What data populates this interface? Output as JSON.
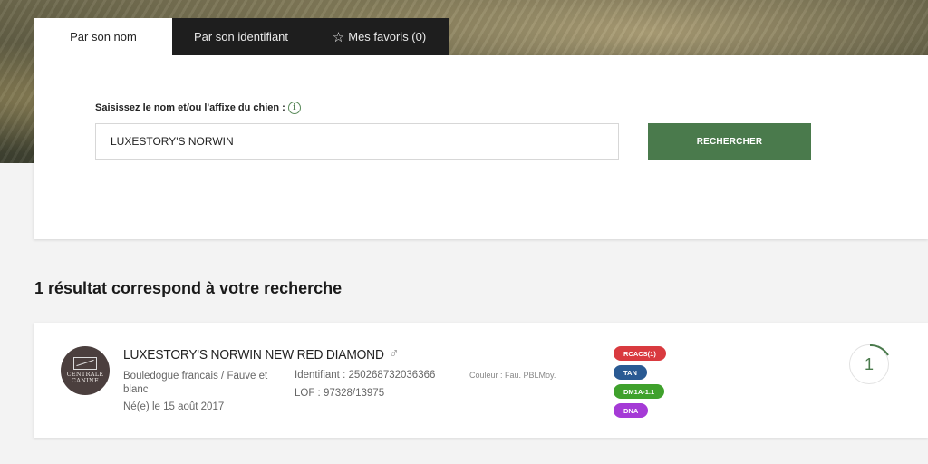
{
  "tabs": [
    {
      "label": "Par son nom",
      "active": true
    },
    {
      "label": "Par son identifiant",
      "active": false
    },
    {
      "label": "Mes favoris (0)",
      "active": false,
      "icon": "star-icon"
    }
  ],
  "search": {
    "label": "Saisissez le nom et/ou l'affixe du chien :",
    "info_icon": "i",
    "value": "LUXESTORY'S NORWIN",
    "button_label": "RECHERCHER"
  },
  "results": {
    "title": "1 résultat correspond à votre recherche",
    "items": [
      {
        "logo_text_1": "CENTRALE",
        "logo_text_2": "CANINE",
        "name": "LUXESTORY'S NORWIN NEW RED DIAMOND",
        "sex_symbol": "♂",
        "breed": "Bouledogue francais / Fauve et blanc",
        "birth": "Né(e) le 15 août 2017",
        "identifiant": "Identifiant : 250268732036366",
        "lof": "LOF : 97328/13975",
        "couleur": "Couleur : Fau. PBLMoy.",
        "badges": [
          {
            "label": "RCACS(1)",
            "color": "#d93a3f"
          },
          {
            "label": "TAN",
            "color": "#2a5a93"
          },
          {
            "label": "DM1A-1.1",
            "color": "#3fa12c"
          },
          {
            "label": "DNA",
            "color": "#a53ad6"
          }
        ],
        "count": "1"
      }
    ]
  },
  "colors": {
    "accent_green": "#4a7a4c",
    "tab_dark": "#1e1e1e"
  }
}
